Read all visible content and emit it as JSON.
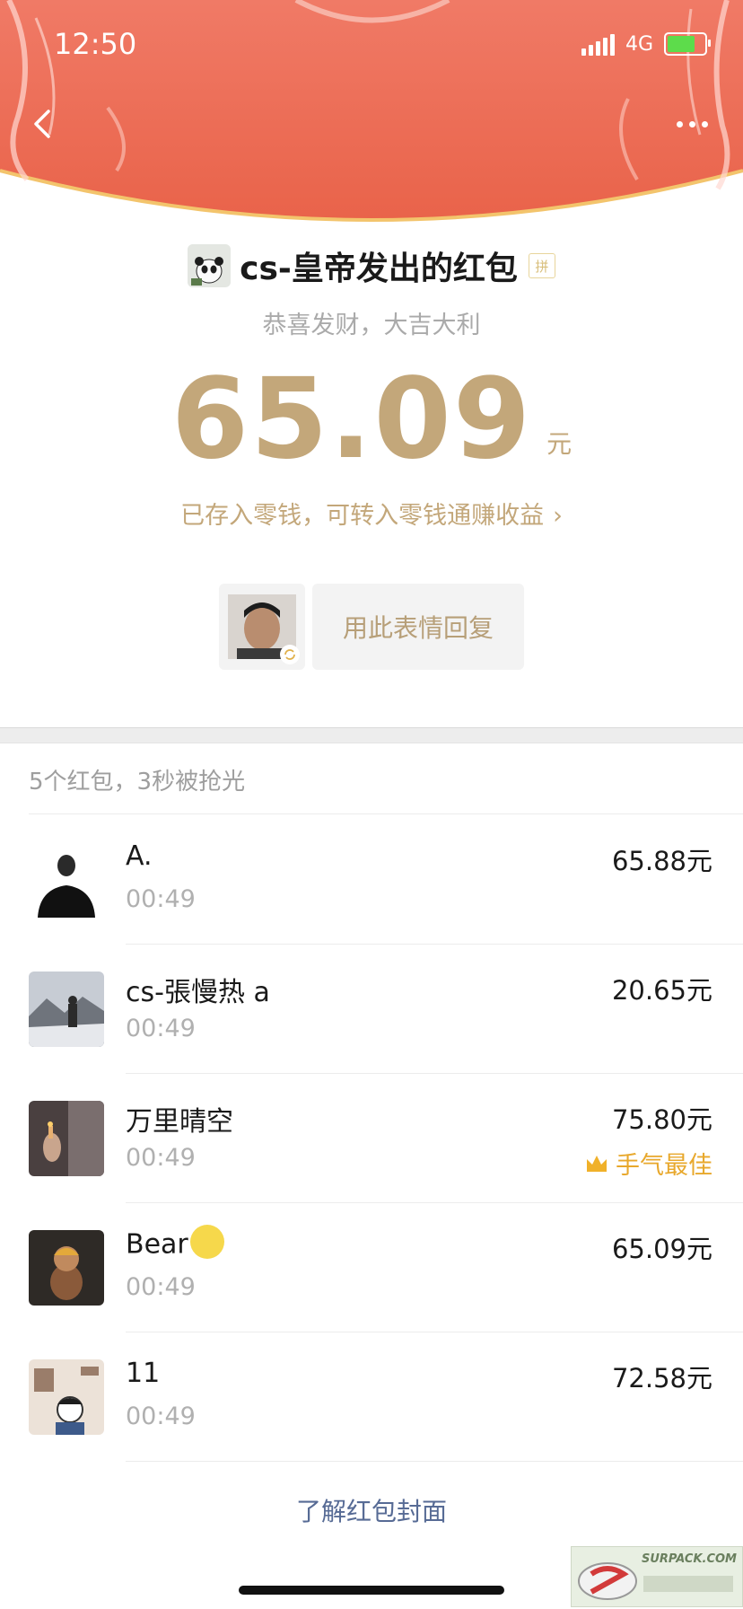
{
  "status_bar": {
    "time": "12:50",
    "network": "4G"
  },
  "sender": {
    "title": "cs-皇帝发出的红包",
    "pin_badge": "拼"
  },
  "blessing": "恭喜发财，大吉大利",
  "amount": {
    "value": "65.09",
    "unit": "元"
  },
  "change_note": "已存入零钱，可转入零钱通赚收益",
  "reply_button": "用此表情回复",
  "summary": "5个红包，3秒被抢光",
  "recipients": [
    {
      "name": "A.",
      "time": "00:49",
      "amount": "65.88元",
      "best": ""
    },
    {
      "name": "cs-張慢热 a",
      "time": "00:49",
      "amount": "20.65元",
      "best": ""
    },
    {
      "name": "万里晴空",
      "time": "00:49",
      "amount": "75.80元",
      "best": "手气最佳"
    },
    {
      "name": "Bear",
      "time": "00:49",
      "amount": "65.09元",
      "best": ""
    },
    {
      "name": "11",
      "time": "00:49",
      "amount": "72.58元",
      "best": ""
    }
  ],
  "cover_link": "了解红包封面",
  "watermark": "SURPACK.COM",
  "colors": {
    "header": "#ec6a50",
    "gold": "#c3a77a",
    "link": "#576b95",
    "best": "#e8a82c"
  }
}
